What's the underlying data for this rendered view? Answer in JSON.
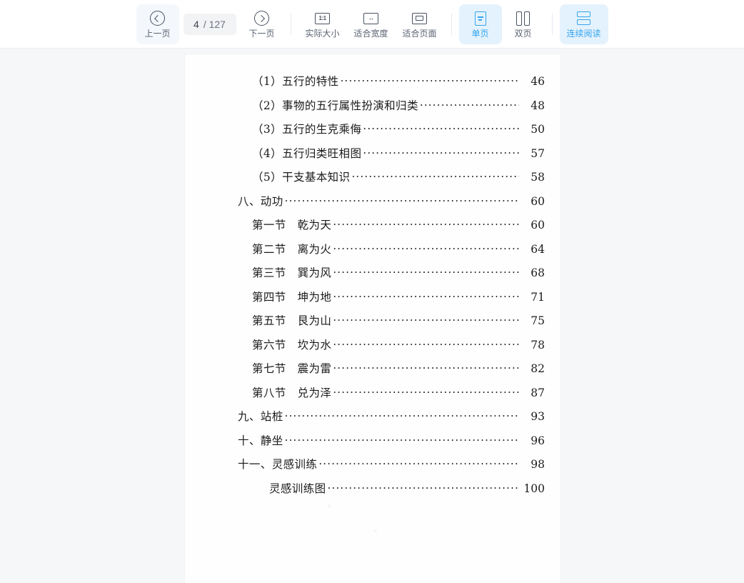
{
  "toolbar": {
    "prev": {
      "label": "上一页",
      "icon": "chevron-left-circle-icon"
    },
    "next": {
      "label": "下一页",
      "icon": "chevron-right-circle-icon"
    },
    "page_indicator": {
      "current": "4",
      "total": "/ 127",
      "placeholder": "4"
    },
    "actual_size": {
      "label": "实际大小",
      "icon": "one-to-one-icon",
      "icon_text": "1:1"
    },
    "fit_width": {
      "label": "适合宽度",
      "icon": "fit-width-icon",
      "icon_text": "↔"
    },
    "fit_page": {
      "label": "适合页面",
      "icon": "fit-page-icon"
    },
    "single_page": {
      "label": "单页",
      "icon": "single-page-icon",
      "active": true
    },
    "dual_page": {
      "label": "双页",
      "icon": "dual-page-icon",
      "active": false
    },
    "continuous": {
      "label": "连续阅读",
      "icon": "continuous-scroll-icon",
      "active": true
    },
    "accent_color": "#34a5f0",
    "accent_bg": "#e4f2fd",
    "text_color": "#5a6372"
  },
  "document": {
    "page_background": "#fefefe",
    "viewer_background": "#f6f7f9",
    "toc": [
      {
        "title": "（1）五行的特性",
        "page": "46",
        "level": 2,
        "gap": true
      },
      {
        "title": "（2）事物的五行属性扮演和归类",
        "page": "48",
        "level": 2,
        "gap": true
      },
      {
        "title": "（3）五行的生克乘侮",
        "page": "50",
        "level": 2,
        "gap": true
      },
      {
        "title": "（4）五行归类旺相图",
        "page": "57",
        "level": 2,
        "gap": true
      },
      {
        "title": "（5）干支基本知识",
        "page": "58",
        "level": 2,
        "gap": true
      },
      {
        "title": "八、动功",
        "page": "60",
        "level": 1,
        "gap": false
      },
      {
        "title": "第一节　乾为天",
        "page": "60",
        "level": 2,
        "gap": false
      },
      {
        "title": "第二节　离为火",
        "page": "64",
        "level": 2,
        "gap": false
      },
      {
        "title": "第三节　巽为风",
        "page": "68",
        "level": 2,
        "gap": false
      },
      {
        "title": "第四节　坤为地",
        "page": "71",
        "level": 2,
        "gap": false
      },
      {
        "title": "第五节　艮为山",
        "page": "75",
        "level": 2,
        "gap": false
      },
      {
        "title": "第六节　坎为水",
        "page": "78",
        "level": 2,
        "gap": false
      },
      {
        "title": "第七节　震为雷",
        "page": "82",
        "level": 2,
        "gap": false
      },
      {
        "title": "第八节　兑为泽",
        "page": "87",
        "level": 2,
        "gap": false
      },
      {
        "title": "九、站桩",
        "page": "93",
        "level": 1,
        "gap": false
      },
      {
        "title": "十、静坐",
        "page": "96",
        "level": 1,
        "gap": false
      },
      {
        "title": "十一、灵感训练",
        "page": "98",
        "level": 1,
        "gap": false
      },
      {
        "title": "灵感训练图",
        "page": "100",
        "level": 3,
        "gap": false
      }
    ]
  }
}
